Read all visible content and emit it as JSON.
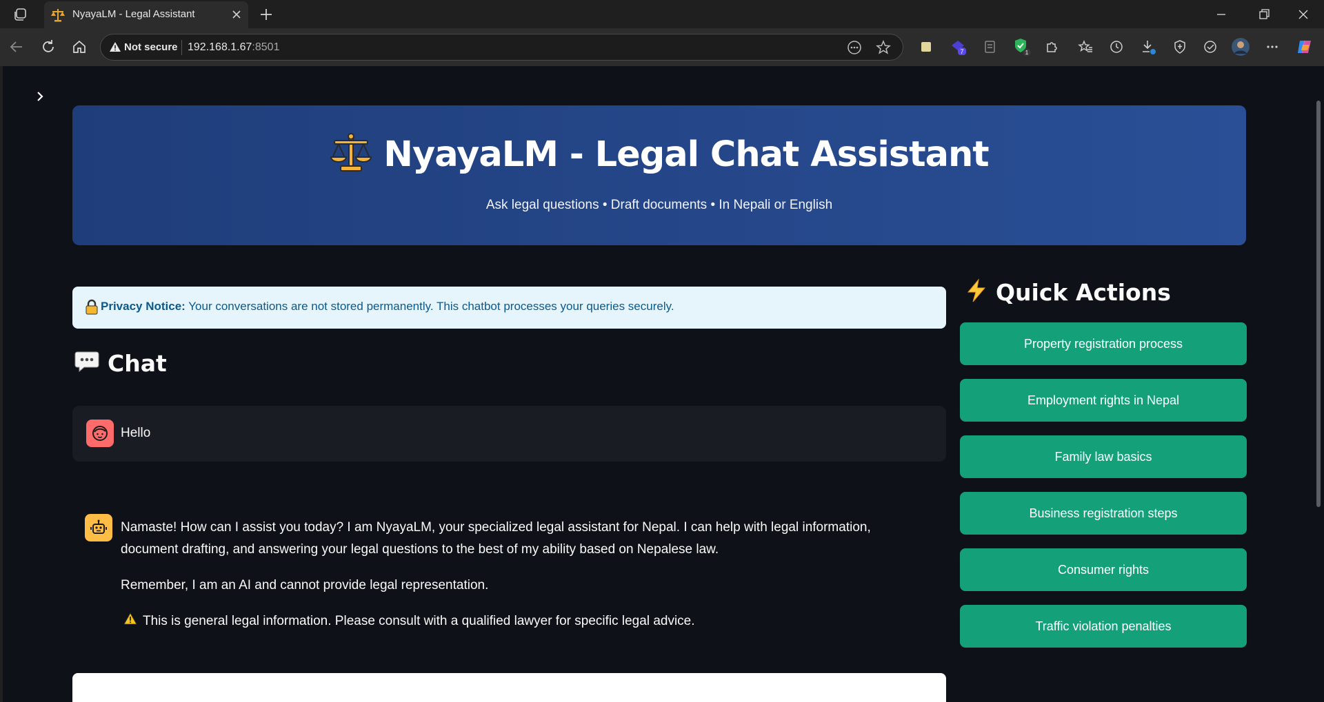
{
  "browser": {
    "tab_title": "NyayaLM - Legal Assistant",
    "security_label": "Not secure",
    "url_host": "192.168.1.67",
    "url_port": ":8501",
    "extension_badges": {
      "purple": "7",
      "shield": "1"
    }
  },
  "hero": {
    "title": "NyayaLM - Legal Chat Assistant",
    "subtitle": "Ask legal questions • Draft documents • In Nepali or English"
  },
  "privacy": {
    "label": "Privacy Notice:",
    "text": "Your conversations are not stored permanently. This chatbot processes your queries securely."
  },
  "chat": {
    "heading": "Chat",
    "user_message": "Hello",
    "assistant_paragraphs": [
      "Namaste! How can I assist you today? I am NyayaLM, your specialized legal assistant for Nepal. I can help with legal information, document drafting, and answering your legal questions to the best of my ability based on Nepalese law.",
      "Remember, I am an AI and cannot provide legal representation."
    ],
    "assistant_disclaimer": "This is general legal information. Please consult with a qualified lawyer for specific legal advice."
  },
  "quick_actions": {
    "heading": "Quick Actions",
    "items": [
      "Property registration process",
      "Employment rights in Nepal",
      "Family law basics",
      "Business registration steps",
      "Consumer rights",
      "Traffic violation penalties"
    ]
  },
  "colors": {
    "page_bg": "#0e1117",
    "hero_bg": "#2a4f96",
    "quick_action_bg": "#14a17a",
    "privacy_bg": "#e6f4fb",
    "user_avatar": "#ff6b6b",
    "bot_avatar": "#ffbd45"
  },
  "icons": [
    "balance-scale-icon",
    "lock-icon",
    "speech-bubble-icon",
    "lightning-icon",
    "warning-icon",
    "user-face-icon",
    "robot-icon"
  ]
}
